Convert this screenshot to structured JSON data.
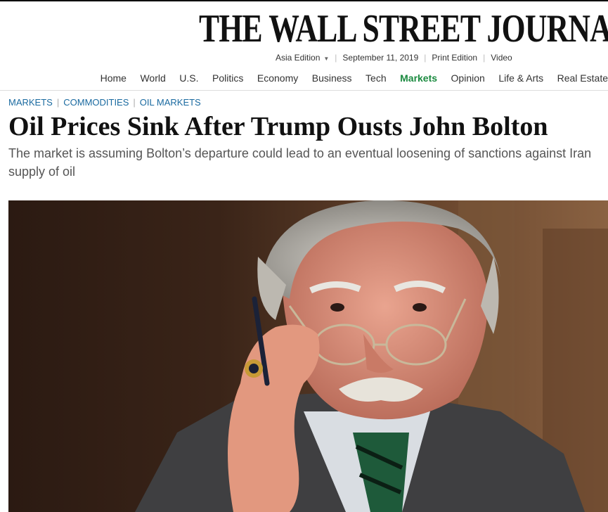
{
  "masthead": {
    "title": "THE WALL STREET JOURNAL."
  },
  "edition_bar": {
    "edition": "Asia Edition",
    "date": "September 11, 2019",
    "print_edition": "Print Edition",
    "video": "Video"
  },
  "nav": {
    "items": [
      "Home",
      "World",
      "U.S.",
      "Politics",
      "Economy",
      "Business",
      "Tech",
      "Markets",
      "Opinion",
      "Life & Arts",
      "Real Estate"
    ],
    "active": "Markets"
  },
  "breadcrumb": {
    "items": [
      "MARKETS",
      "COMMODITIES",
      "OIL MARKETS"
    ]
  },
  "article": {
    "headline": "Oil Prices Sink After Trump Ousts John Bolton",
    "dek_line1": "The market is assuming Bolton’s departure could lead to an eventual loosening of sanctions against Iran",
    "dek_line2": "supply of oil"
  },
  "colors": {
    "accent_markets": "#1a8a3f",
    "link_blue": "#1a6aa0"
  }
}
